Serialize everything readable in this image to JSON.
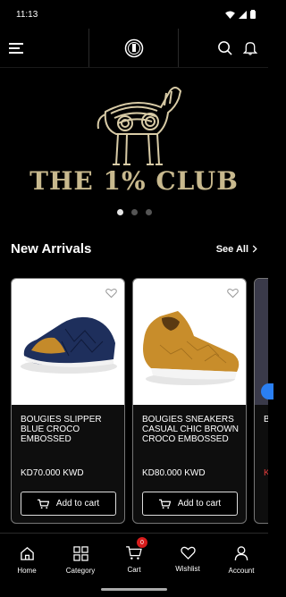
{
  "status_bar": {
    "time": "11:13"
  },
  "header": {
    "menu_icon": "hamburger-icon",
    "logo_icon": "club-logo-icon",
    "search_icon": "search-icon",
    "bell_icon": "bell-icon"
  },
  "banner": {
    "brand_title": "THE 1% CLUB",
    "slides": 3,
    "active_slide": 1
  },
  "section": {
    "title": "New Arrivals",
    "see_all": "See All"
  },
  "products": [
    {
      "name": "BOUGIES SLIPPER BLUE CROCO EMBOSSED",
      "price": "KD70.000 KWD",
      "button": "Add to cart"
    },
    {
      "name": "BOUGIES SNEAKERS CASUAL CHIC BROWN CROCO EMBOSSED",
      "price": "KD80.000 KWD",
      "button": "Add to cart"
    },
    {
      "name": "B",
      "price": "K"
    }
  ],
  "bottom_nav": [
    {
      "label": "Home",
      "icon": "home-icon"
    },
    {
      "label": "Category",
      "icon": "grid-icon"
    },
    {
      "label": "Cart",
      "icon": "cart-icon",
      "badge": "0"
    },
    {
      "label": "Wishlist",
      "icon": "heart-icon"
    },
    {
      "label": "Account",
      "icon": "user-icon"
    }
  ],
  "colors": {
    "background": "#000000",
    "brand_gold": "#c8b98e",
    "badge_red": "#d71c1c",
    "shoe_blue": "#1e2f5c",
    "shoe_tan": "#c88d2b"
  }
}
